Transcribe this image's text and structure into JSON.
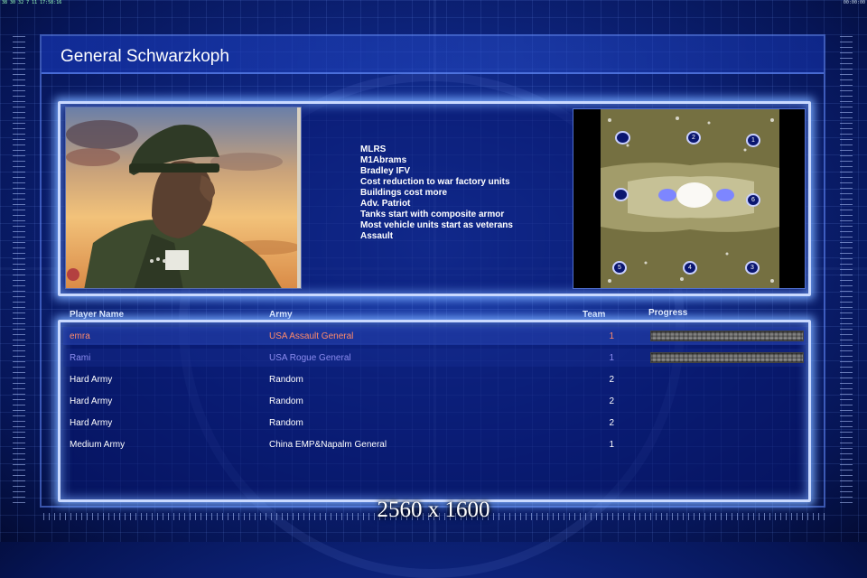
{
  "status_bar": {
    "left": "38 30 32 7 11 17:58:16",
    "right": "00:00:00"
  },
  "general_name": "General Schwarzkoph",
  "bonuses": [
    "MLRS",
    "M1Abrams",
    "Bradley IFV",
    "Cost reduction to war factory units",
    "Buildings cost more",
    "Adv. Patriot",
    "Tanks start with composite armor",
    "Most vehicle units start as veterans",
    "Assault"
  ],
  "map_slots": [
    "2",
    "1",
    "6",
    "5",
    "4",
    "3"
  ],
  "columns": {
    "player_name": "Player Name",
    "army": "Army",
    "team": "Team",
    "progress": "Progress"
  },
  "players": [
    {
      "name": "emra",
      "army": "USA Assault General",
      "team": "1",
      "color": "#ff8a6a",
      "progress": 1.0
    },
    {
      "name": "Rami",
      "army": "USA Rogue General",
      "team": "1",
      "color": "#8c8cf0",
      "progress": 1.0
    },
    {
      "name": "Hard Army",
      "army": "Random",
      "team": "2",
      "color": "#ffffff"
    },
    {
      "name": "Hard Army",
      "army": "Random",
      "team": "2",
      "color": "#ffffff"
    },
    {
      "name": "Hard Army",
      "army": "Random",
      "team": "2",
      "color": "#ffffff"
    },
    {
      "name": "Medium Army",
      "army": "China EMP&Napalm General",
      "team": "1",
      "color": "#ffffff"
    }
  ],
  "resolution_label": "2560 x 1600",
  "colors": {
    "background": "#0e2580",
    "panel_glow": "#78aaff",
    "accent_frame": "#c9d9ff"
  }
}
